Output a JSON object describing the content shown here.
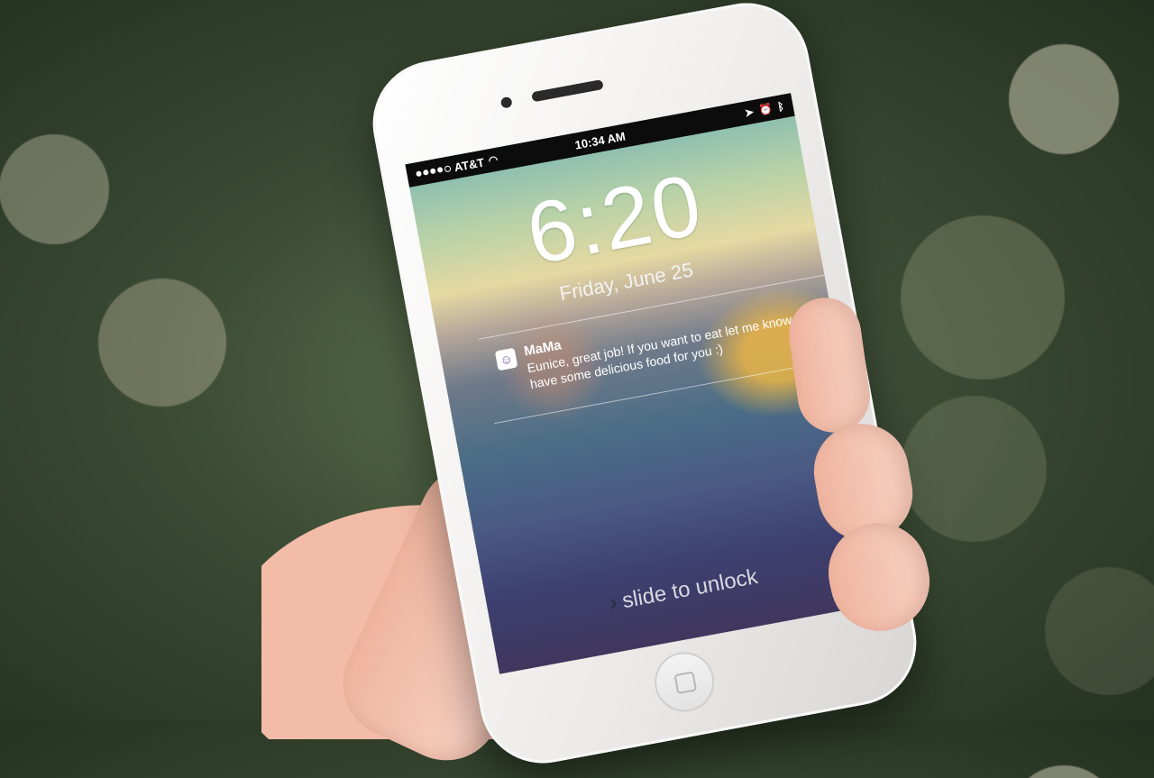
{
  "status_bar": {
    "carrier": "AT&T",
    "time": "10:34 AM",
    "icons": [
      "location-icon",
      "alarm-icon",
      "bluetooth-icon"
    ]
  },
  "lock_screen": {
    "time": "6:20",
    "date": "Friday, June 25"
  },
  "notification": {
    "sender": "MaMa",
    "message": "Eunice, great job! If you want to eat let me know, I have some delicious food for you :)"
  },
  "unlock": {
    "label": "slide to unlock"
  }
}
